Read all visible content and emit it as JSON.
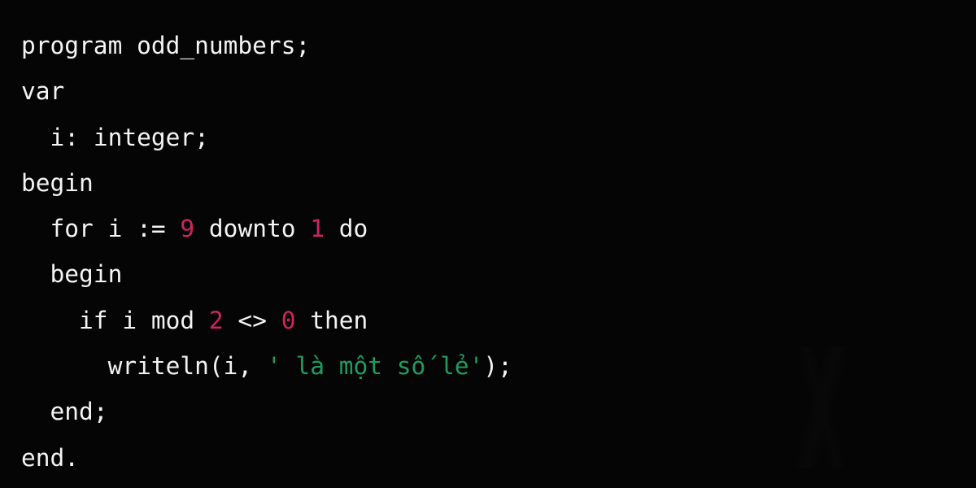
{
  "editor": {
    "language": "Pascal",
    "background_color": "#050505",
    "default_text_color": "#f4f4f4",
    "theme_colors": {
      "number": "#cf2362",
      "function": "#d4791c",
      "string": "#1e9c5e",
      "keyword": "#f4f4f4",
      "punctuation": "#f4f4f4"
    }
  },
  "code": {
    "lines": [
      {
        "indent": "",
        "tokens": [
          {
            "text": "program odd_numbers;",
            "type": "plain"
          }
        ]
      },
      {
        "indent": "",
        "tokens": [
          {
            "text": "var",
            "type": "keyword"
          }
        ]
      },
      {
        "indent": "  ",
        "tokens": [
          {
            "text": "i: integer;",
            "type": "plain"
          }
        ]
      },
      {
        "indent": "",
        "tokens": [
          {
            "text": "begin",
            "type": "keyword"
          }
        ]
      },
      {
        "indent": "  ",
        "tokens": [
          {
            "text": "for i := ",
            "type": "plain"
          },
          {
            "text": "9",
            "type": "number"
          },
          {
            "text": " downto ",
            "type": "plain"
          },
          {
            "text": "1",
            "type": "number"
          },
          {
            "text": " do",
            "type": "plain"
          }
        ]
      },
      {
        "indent": "  ",
        "tokens": [
          {
            "text": "begin",
            "type": "keyword"
          }
        ]
      },
      {
        "indent": "    ",
        "tokens": [
          {
            "text": "if i mod ",
            "type": "plain"
          },
          {
            "text": "2",
            "type": "number"
          },
          {
            "text": " <> ",
            "type": "plain"
          },
          {
            "text": "0",
            "type": "number"
          },
          {
            "text": " then",
            "type": "plain"
          }
        ]
      },
      {
        "indent": "      ",
        "tokens": [
          {
            "text": "writeln",
            "type": "function"
          },
          {
            "text": "(i, ",
            "type": "plain"
          },
          {
            "text": "' là một số lẻ'",
            "type": "string"
          },
          {
            "text": ");",
            "type": "plain"
          }
        ]
      },
      {
        "indent": "  ",
        "tokens": [
          {
            "text": "end;",
            "type": "plain"
          }
        ]
      },
      {
        "indent": "",
        "tokens": [
          {
            "text": "end.",
            "type": "plain"
          }
        ]
      }
    ]
  }
}
